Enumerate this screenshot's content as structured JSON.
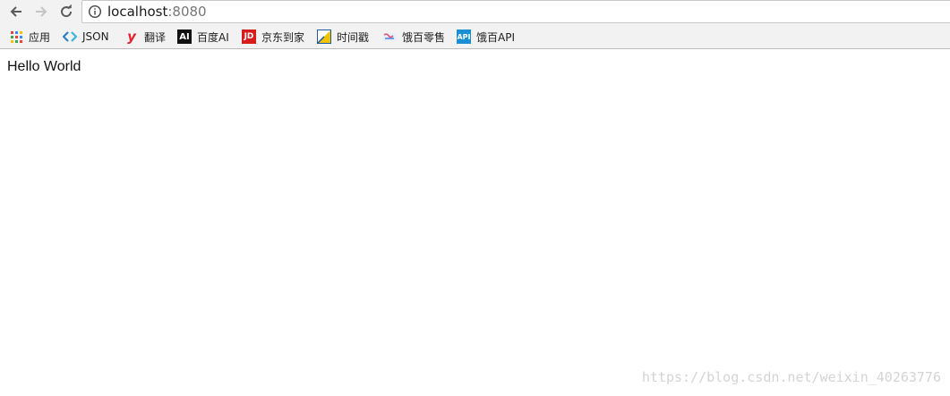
{
  "address_bar": {
    "host": "localhost",
    "port": ":8080"
  },
  "nav": {
    "back_icon": "arrow-left",
    "forward_icon": "arrow-right",
    "reload_icon": "reload"
  },
  "bookmarks": [
    {
      "label": "应用",
      "icon": "apps-grid-icon"
    },
    {
      "label": "JSON",
      "icon": "json-icon"
    },
    {
      "label": "翻译",
      "icon": "youdao-icon",
      "icon_text": "y"
    },
    {
      "label": "百度AI",
      "icon": "baidu-ai-icon",
      "icon_text": "AI"
    },
    {
      "label": "京东到家",
      "icon": "jd-icon",
      "icon_text": "JD"
    },
    {
      "label": "时间戳",
      "icon": "timestamp-icon"
    },
    {
      "label": "饿百零售",
      "icon": "ebai-icon"
    },
    {
      "label": "饿百API",
      "icon": "api-icon",
      "icon_text": "API"
    }
  ],
  "page": {
    "text": "Hello World"
  },
  "watermark": "https://blog.csdn.net/weixin_40263776",
  "colors": {
    "toolbar_bg": "#f2f2f2",
    "baidu_ai_icon": "#1a1a1a",
    "jd_icon": "#d71c1e",
    "youdao_icon": "#e8202a",
    "api_icon": "#1b8fd6"
  }
}
